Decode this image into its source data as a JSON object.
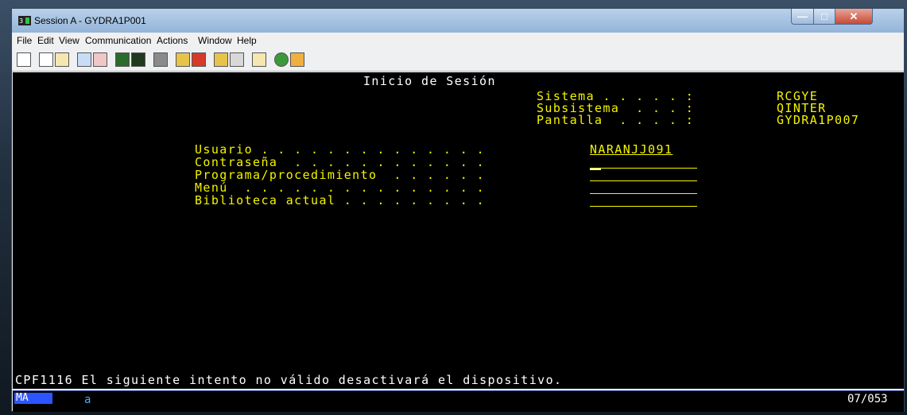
{
  "window": {
    "title": "Session A - GYDRA1P001"
  },
  "menu": [
    "File",
    "Edit",
    "View",
    "Communication",
    "Actions",
    "Window",
    "Help"
  ],
  "toolbar_icons": [
    "print-screen-icon",
    "copy-icon",
    "paste-icon",
    "send-icon",
    "receive-icon",
    "display-icon",
    "keyboard-icon",
    "macro-icon",
    "record-macro-icon",
    "stop-macro-icon",
    "play-macro-icon",
    "pause-macro-icon",
    "clipboard-icon",
    "globe-icon",
    "edit-icon"
  ],
  "screen": {
    "heading": "Inicio de Sesión",
    "sys_labels": [
      "Sistema . . . . . :",
      "Subsistema  . . . :",
      "Pantalla  . . . . :"
    ],
    "sys_values": [
      "RCGYE",
      "QINTER",
      "GYDRA1P007"
    ],
    "fields": [
      {
        "label": "Usuario . . . . . . . . . . . . . .",
        "value": "NARANJJ091"
      },
      {
        "label": "Contraseña  . . . . . . . . . . . .",
        "value": ""
      },
      {
        "label": "Programa/procedimiento  . . . . . .",
        "value": ""
      },
      {
        "label": "Menú  . . . . . . . . . . . . . . .",
        "value": ""
      },
      {
        "label": "Biblioteca actual . . . . . . . . .",
        "value": ""
      }
    ],
    "message": "CPF1116 El siguiente intento no válido desactivará el dispositivo."
  },
  "status": {
    "mode": "MA",
    "indicator": "a",
    "cursor_pos": "07/053"
  }
}
